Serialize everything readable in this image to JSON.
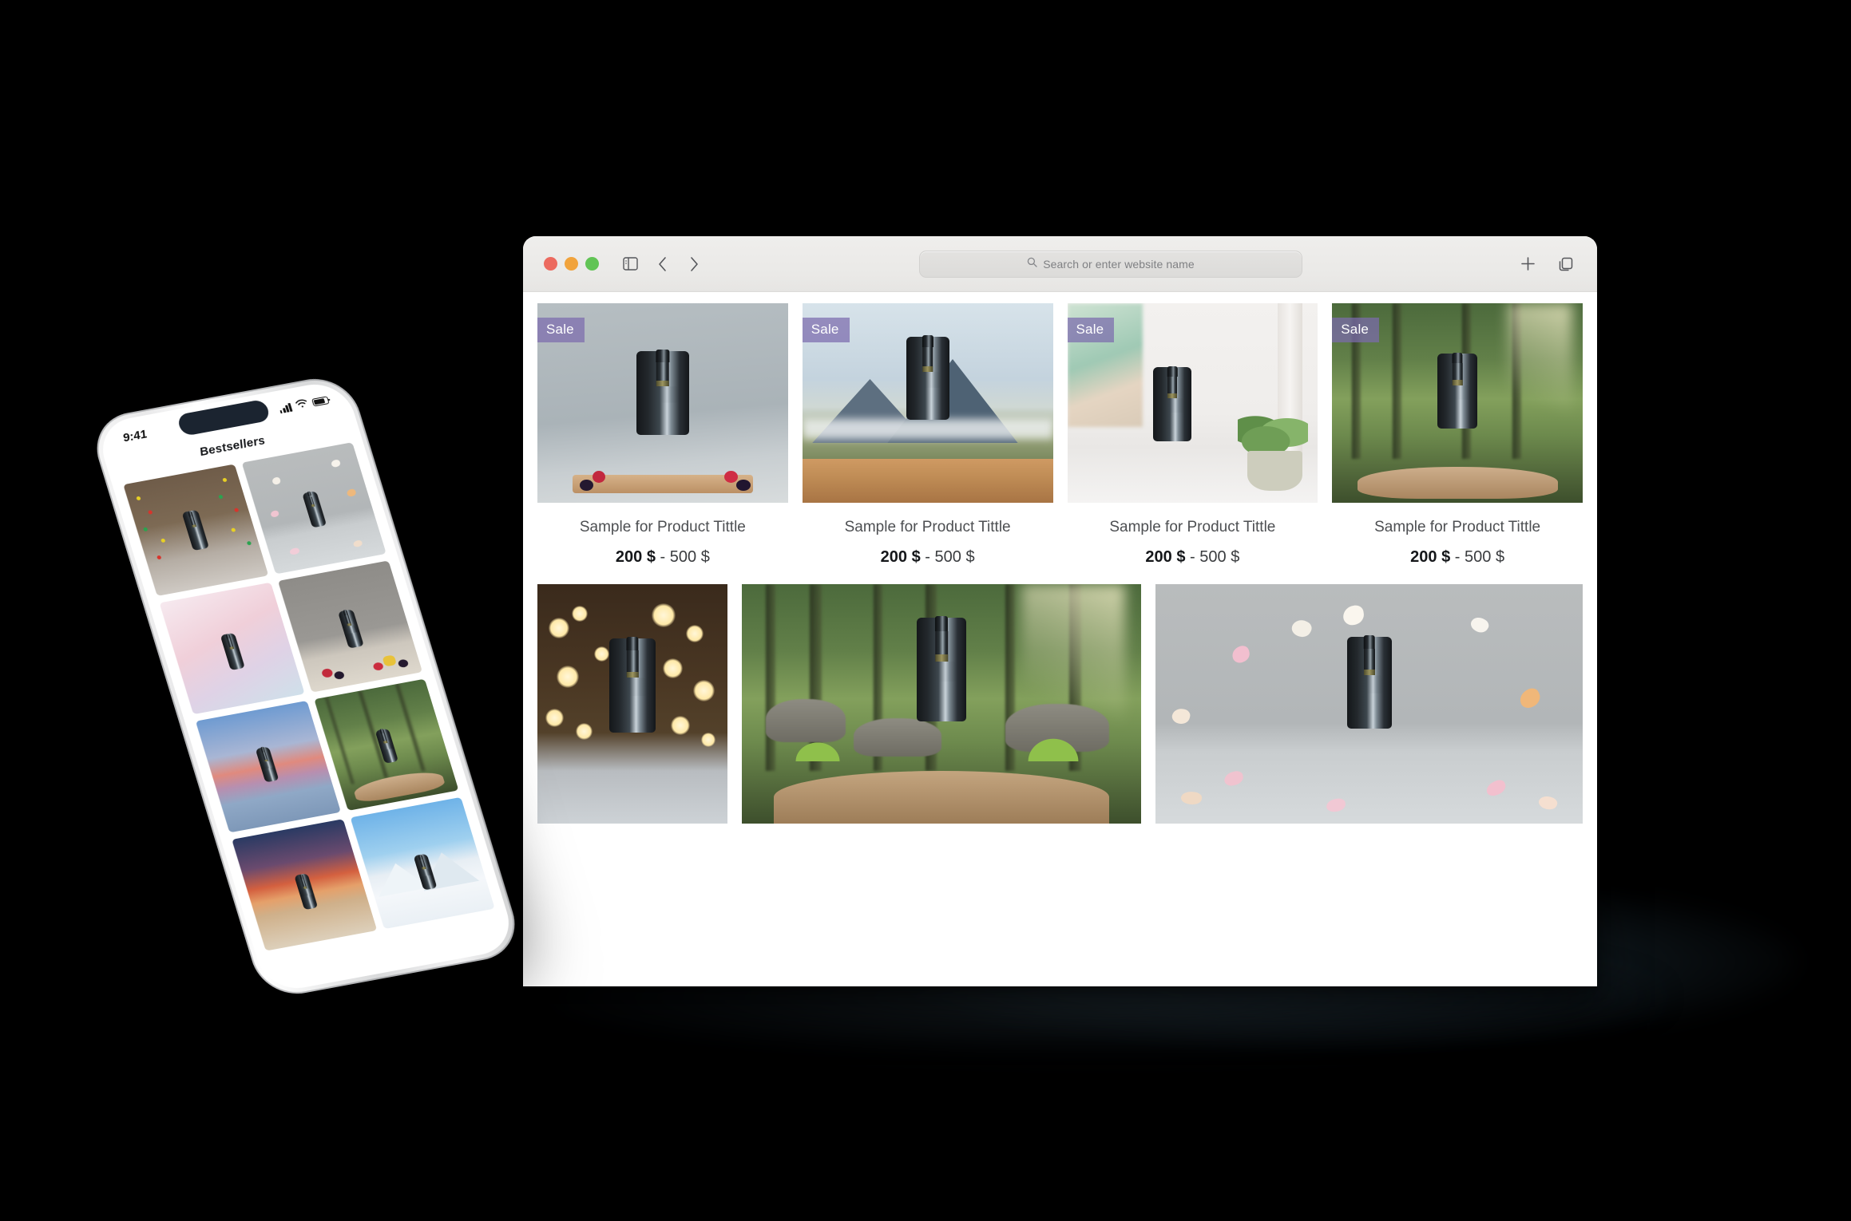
{
  "browser": {
    "window_controls": [
      {
        "name": "close",
        "color": "#ec6a5f"
      },
      {
        "name": "minimize",
        "color": "#f1a33c"
      },
      {
        "name": "maximize",
        "color": "#61c455"
      }
    ],
    "toolbar": {
      "sidebar_icon": "sidebar-icon",
      "back_icon": "chevron-left-icon",
      "forward_icon": "chevron-right-icon",
      "new_tab_icon": "plus-icon",
      "tab_overview_icon": "copy-tabs-icon"
    },
    "address_bar": {
      "search_icon": "search-icon",
      "placeholder": "Search or enter website name",
      "value": ""
    },
    "products": [
      {
        "badge": "Sale",
        "title": "Sample for Product Tittle",
        "price_from": "200 $",
        "price_sep": " - ",
        "price_to": "500 $",
        "scene": "grey-studio-berries"
      },
      {
        "badge": "Sale",
        "title": "Sample for Product Tittle",
        "price_from": "200 $",
        "price_sep": " - ",
        "price_to": "500 $",
        "scene": "mountain-table"
      },
      {
        "badge": "Sale",
        "title": "Sample for Product Tittle",
        "price_from": "200 $",
        "price_sep": " - ",
        "price_to": "500 $",
        "scene": "bright-interior-plant"
      },
      {
        "badge": "Sale",
        "title": "Sample for Product Tittle",
        "price_from": "200 $",
        "price_sep": " - ",
        "price_to": "500 $",
        "scene": "forest-wood-slab"
      }
    ],
    "gallery": [
      {
        "scene": "golden-bokeh"
      },
      {
        "scene": "forest-stone-wide"
      },
      {
        "scene": "falling-petals"
      }
    ],
    "badge_color": "#7c6bad",
    "badge_text_color": "#ffffff"
  },
  "phone": {
    "status": {
      "time": "9:41",
      "signal_icon": "cellular-signal-icon",
      "wifi_icon": "wifi-icon",
      "battery_icon": "battery-icon"
    },
    "title": "Bestsellers",
    "grid": [
      {
        "scene": "christmas-lights"
      },
      {
        "scene": "petals-grey"
      },
      {
        "scene": "pink-gradient"
      },
      {
        "scene": "fruit-table"
      },
      {
        "scene": "dusk-lake"
      },
      {
        "scene": "forest-rock"
      },
      {
        "scene": "desert-sunset"
      },
      {
        "scene": "snow-mountains"
      }
    ]
  }
}
